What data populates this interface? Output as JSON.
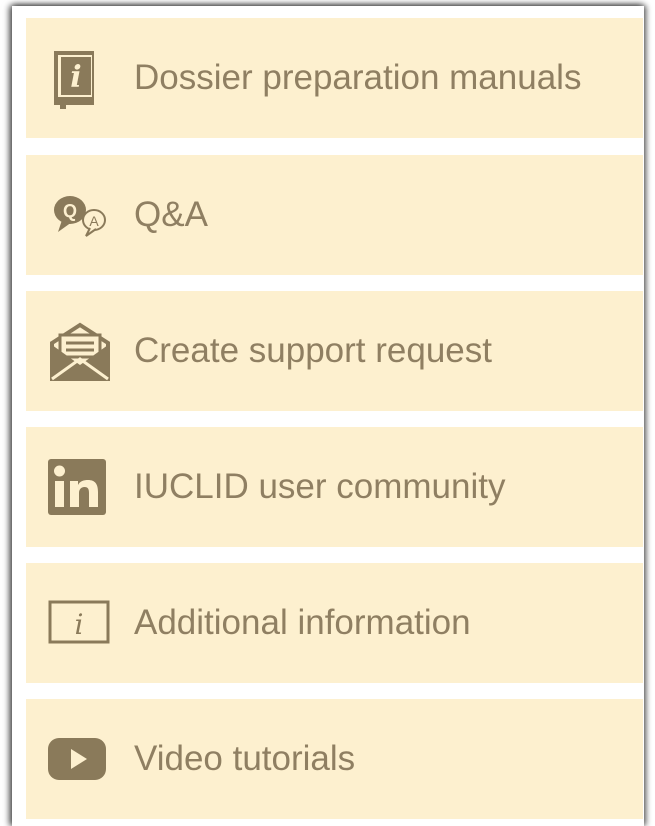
{
  "menu": {
    "items": [
      {
        "label": "Dossier preparation manuals",
        "icon": "manual-book-icon"
      },
      {
        "label": "Q&A",
        "icon": "qa-bubbles-icon"
      },
      {
        "label": "Create support request",
        "icon": "envelope-icon"
      },
      {
        "label": "IUCLID user community",
        "icon": "linkedin-icon"
      },
      {
        "label": "Additional information",
        "icon": "info-box-icon"
      },
      {
        "label": "Video tutorials",
        "icon": "youtube-play-icon"
      }
    ]
  },
  "colors": {
    "item_background": "#fdf0cf",
    "text": "#8f7f62",
    "icon": "#8a7a5a"
  }
}
